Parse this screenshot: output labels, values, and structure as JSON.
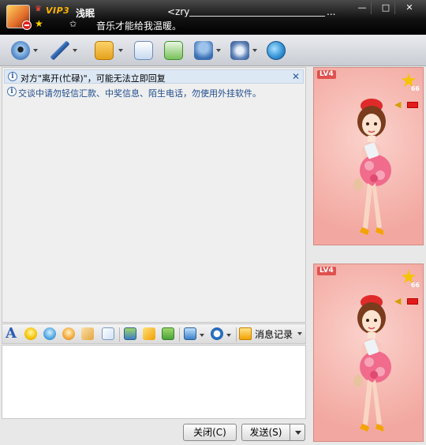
{
  "title": {
    "vip_badge": "VIP3",
    "nickname": "浅眠",
    "signature": "音乐才能给我温暖。",
    "remark": "<zry",
    "more": "...",
    "status_icon": "star-outline-icon",
    "window_buttons": {
      "minimize": "—",
      "maximize": "□",
      "close": "✕"
    }
  },
  "toolbar": {
    "items": [
      "video-call-icon",
      "voice-call-icon",
      "send-file-icon",
      "send-sms-icon",
      "add-app-icon",
      "group-chat-icon",
      "settings-icon",
      "remote-assist-icon"
    ]
  },
  "chat": {
    "notice": "对方\"离开(忙碌)\"，可能无法立即回复",
    "notice_close": "✕",
    "warning": "交谈中请勿轻信汇款、中奖信息、陌生电话，勿使用外挂软件。"
  },
  "format_bar": {
    "font_glyph": "A",
    "history_label": "消息记录"
  },
  "buttons": {
    "close": "关闭(C)",
    "send": "发送(S)"
  },
  "show": {
    "level": "LV4",
    "star_count": "66",
    "star_glyph": "★",
    "sound_glyph": "◀"
  },
  "colors": {
    "titlebar": "#000000",
    "accent_blue": "#2a5aa0",
    "show_bg": "#f2a8a0",
    "vip_gold": "#ffb400"
  }
}
